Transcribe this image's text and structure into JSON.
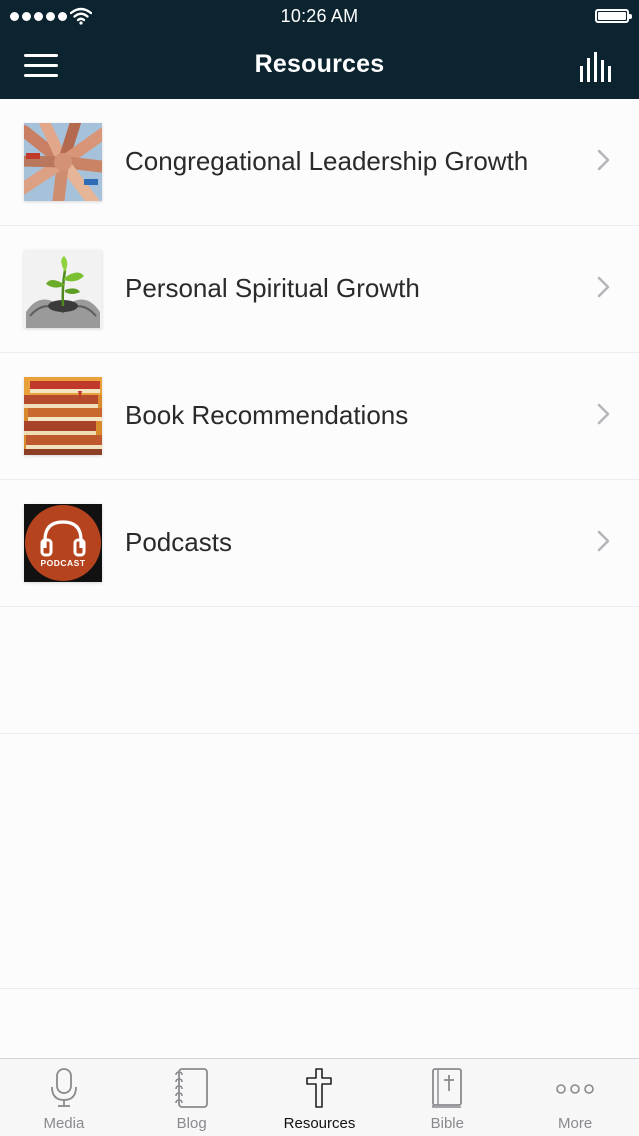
{
  "status_bar": {
    "time": "10:26 AM"
  },
  "nav": {
    "title": "Resources",
    "left_icon": "hamburger-menu-icon",
    "right_icon": "bar-chart-icon"
  },
  "resources": [
    {
      "label": "Congregational Leadership Growth",
      "thumbnail": "hands-together-thumbnail"
    },
    {
      "label": "Personal Spiritual Growth",
      "thumbnail": "sprout-in-hands-thumbnail"
    },
    {
      "label": "Book Recommendations",
      "thumbnail": "book-stack-thumbnail"
    },
    {
      "label": "Podcasts",
      "thumbnail": "podcast-headphones-thumbnail",
      "thumbnail_text": "PODCAST"
    }
  ],
  "tabs": [
    {
      "label": "Media",
      "icon": "microphone-icon"
    },
    {
      "label": "Blog",
      "icon": "notebook-icon"
    },
    {
      "label": "Resources",
      "icon": "cross-icon",
      "active": true
    },
    {
      "label": "Bible",
      "icon": "bible-icon"
    },
    {
      "label": "More",
      "icon": "more-dots-icon"
    }
  ],
  "colors": {
    "header_bg": "#0c2430",
    "podcast_badge": "#b5441e",
    "tab_active": "#111111",
    "tab_inactive": "#8a8a8e"
  }
}
